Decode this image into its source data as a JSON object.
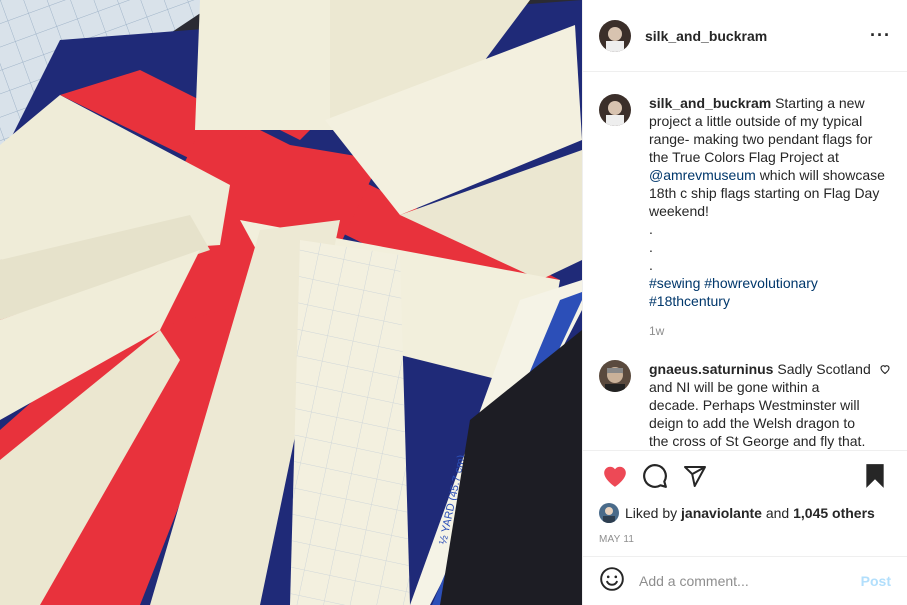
{
  "post": {
    "author": "silk_and_buckram",
    "more_icon": "more-horizontal-icon",
    "caption": {
      "username": "silk_and_buckram",
      "text_1": "Starting a new project a little outside of my typical range- making two pendant flags for the True Colors Flag Project at",
      "mention": "@amrevmuseum",
      "text_2": "which will showcase 18th c ship flags starting on Flag Day weekend!",
      "dots": [
        ".",
        ".",
        "."
      ],
      "hashtags_line_1": "#sewing #howrevolutionary",
      "hashtags_line_2": "#18thcentury",
      "time": "1w"
    },
    "comments": [
      {
        "username": "gnaeus.saturninus",
        "text": "Sadly Scotland and NI will be gone within a decade. Perhaps Westminster will deign to add the Welsh dragon to the cross of St George and fly that."
      }
    ],
    "likes": {
      "prefix": "Liked by",
      "user": "janaviolante",
      "conjunction": "and",
      "others": "1,045 others"
    },
    "date": "MAY 11",
    "add_comment_placeholder": "Add a comment...",
    "post_label": "Post",
    "icons": {
      "like": "heart-filled-icon",
      "comment": "comment-icon",
      "share": "paper-plane-icon",
      "save": "bookmark-filled-icon",
      "emoji": "smiley-icon"
    },
    "colors": {
      "like_red": "#ed4956",
      "link_blue": "#00376b",
      "post_button": "#b2dffc",
      "flag_red": "#e8323c",
      "flag_blue": "#1f2a78",
      "linen": "#f1eedb"
    }
  }
}
